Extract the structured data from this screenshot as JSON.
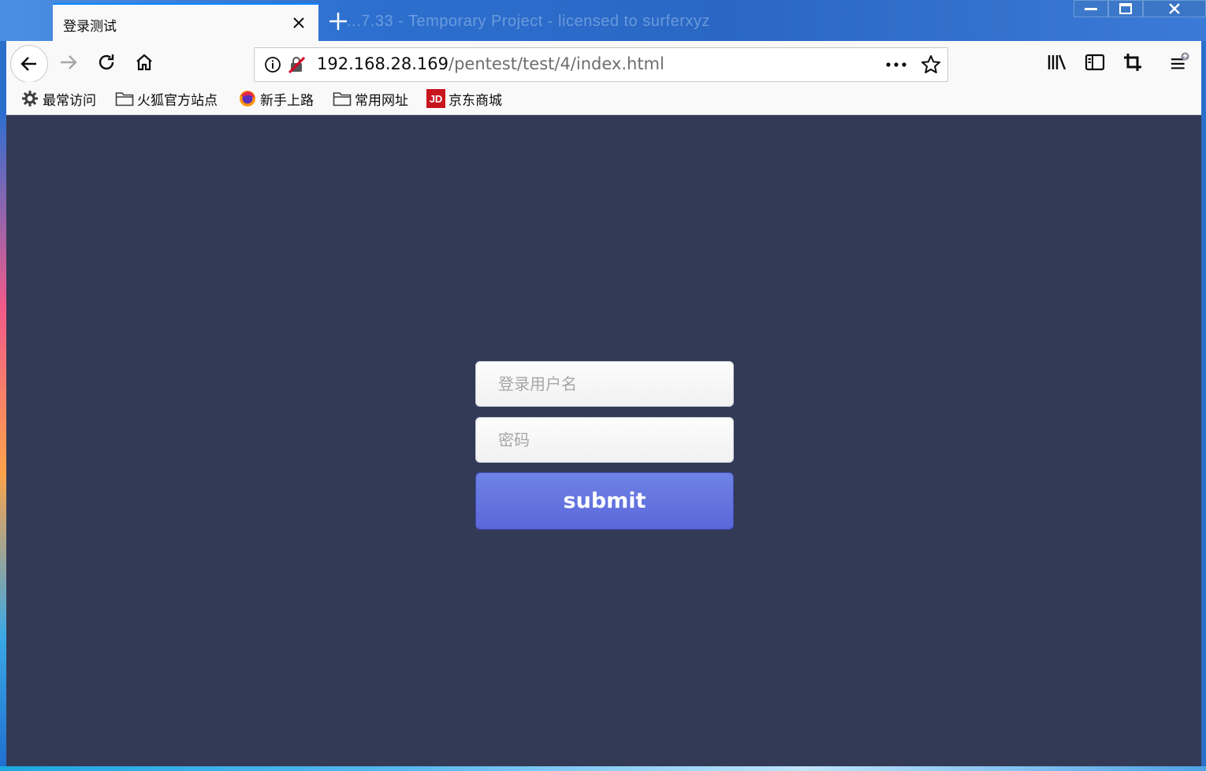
{
  "window": {
    "background_title": "...7.33 - Temporary Project - licensed to surferxyz"
  },
  "tab": {
    "title": "登录测试"
  },
  "url": {
    "host": "192.168.28.169",
    "path": "/pentest/test/4/index.html"
  },
  "bookmarks": [
    {
      "label": "最常访问",
      "icon": "gear-icon"
    },
    {
      "label": "火狐官方站点",
      "icon": "folder-icon"
    },
    {
      "label": "新手上路",
      "icon": "firefox-icon"
    },
    {
      "label": "常用网址",
      "icon": "folder-icon"
    },
    {
      "label": "京东商城",
      "icon": "jd-icon"
    }
  ],
  "jd_badge": "JD",
  "login": {
    "username_placeholder": "登录用户名",
    "password_placeholder": "密码",
    "submit_label": "submit"
  },
  "colors": {
    "page_background": "#333a56",
    "submit_button": "#5f6fdd",
    "tab_accent": "#0a84ff"
  }
}
